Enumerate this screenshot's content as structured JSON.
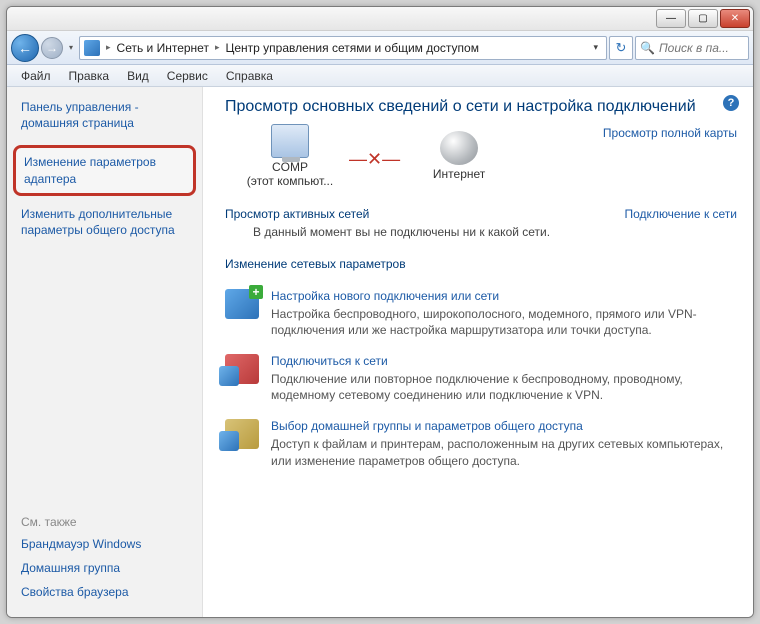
{
  "titlebar": {
    "minimize": "—",
    "maximize": "▢",
    "close": "✕"
  },
  "nav": {
    "back": "←",
    "fwd": "→",
    "dd": "▾",
    "crumb1": "Сеть и Интернет",
    "crumb2": "Центр управления сетями и общим доступом",
    "chev": "▸",
    "dd_end": "▾",
    "refresh": "↻"
  },
  "search": {
    "placeholder": "Поиск в па..."
  },
  "menu": {
    "file": "Файл",
    "edit": "Правка",
    "view": "Вид",
    "service": "Сервис",
    "help": "Справка"
  },
  "sidebar": {
    "home": "Панель управления - домашняя страница",
    "link1": "Изменение параметров адаптера",
    "link2": "Изменить дополнительные параметры общего доступа",
    "see_also_hdr": "См. также",
    "sa1": "Брандмауэр Windows",
    "sa2": "Домашняя группа",
    "sa3": "Свойства браузера"
  },
  "main": {
    "help": "?",
    "h1": "Просмотр основных сведений о сети и настройка подключений",
    "map_full": "Просмотр полной карты",
    "node1_name": "COMP",
    "node1_sub": "(этот компьют...",
    "node2_name": "Интернет",
    "arrow": "—✕—",
    "section1_hdr": "Просмотр активных сетей",
    "section1_link": "Подключение к сети",
    "section1_body": "В данный момент вы не подключены ни к какой сети.",
    "section2_hdr": "Изменение сетевых параметров",
    "opt1_title": "Настройка нового подключения или сети",
    "opt1_desc": "Настройка беспроводного, широкополосного, модемного, прямого или VPN-подключения или же настройка маршрутизатора или точки доступа.",
    "opt2_title": "Подключиться к сети",
    "opt2_desc": "Подключение или повторное подключение к беспроводному, проводному, модемному сетевому соединению или подключение к VPN.",
    "opt3_title": "Выбор домашней группы и параметров общего доступа",
    "opt3_desc": "Доступ к файлам и принтерам, расположенным на других сетевых компьютерах, или изменение параметров общего доступа."
  }
}
